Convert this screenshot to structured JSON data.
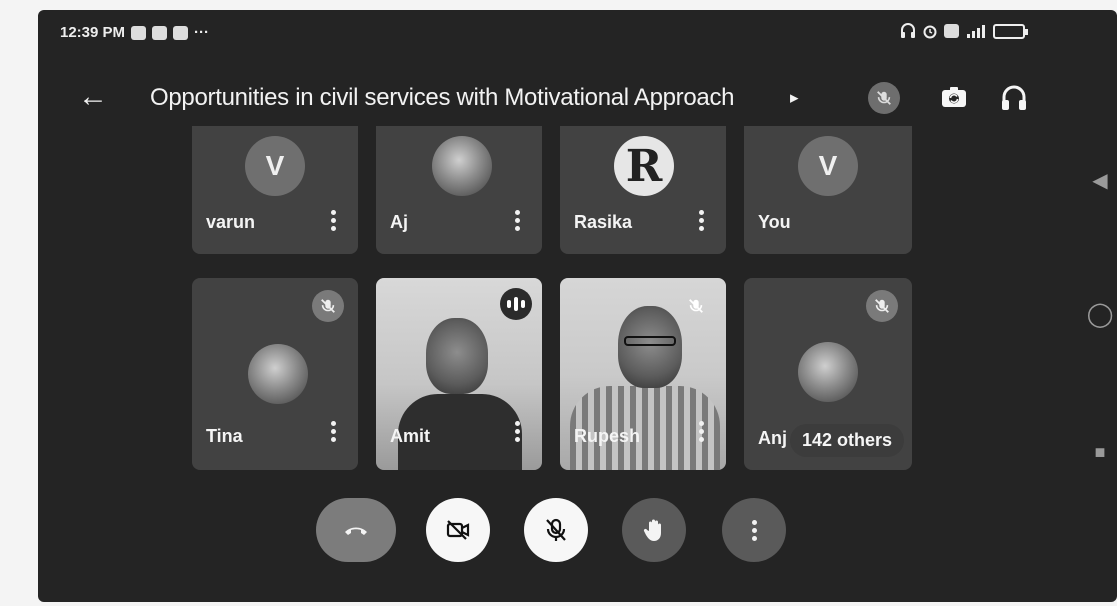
{
  "status_bar": {
    "time": "12:39 PM",
    "overflow": "···"
  },
  "header": {
    "title": "Opportunities in civil services with Motivational Approach",
    "title_chevron": "▸"
  },
  "tiles_top": [
    {
      "name": "varun",
      "avatar_letter": "V",
      "avatar_type": "letter"
    },
    {
      "name": "Aj",
      "avatar_letter": "",
      "avatar_type": "photo"
    },
    {
      "name": "Rasika",
      "avatar_letter": "R",
      "avatar_type": "photo-r"
    },
    {
      "name": "You",
      "avatar_letter": "V",
      "avatar_type": "letter"
    }
  ],
  "tiles_bottom": [
    {
      "name": "Tina",
      "muted": true,
      "video": false
    },
    {
      "name": "Amit",
      "muted": false,
      "speaking": true,
      "video": true
    },
    {
      "name": "Rupesh",
      "muted": true,
      "video": true
    },
    {
      "name": "Anj",
      "muted": true,
      "video": false,
      "others_label": "142 others"
    }
  ],
  "controls": [
    "hang-up",
    "camera-off",
    "microphone-off",
    "raise-hand",
    "more-options"
  ],
  "icons": {
    "back": "←",
    "nav_back": "◀",
    "nav_home": "◯",
    "nav_recents": "■"
  },
  "colors": {
    "screen_bg": "#242424",
    "tile_bg": "#424242",
    "text": "#f4f4f4"
  }
}
